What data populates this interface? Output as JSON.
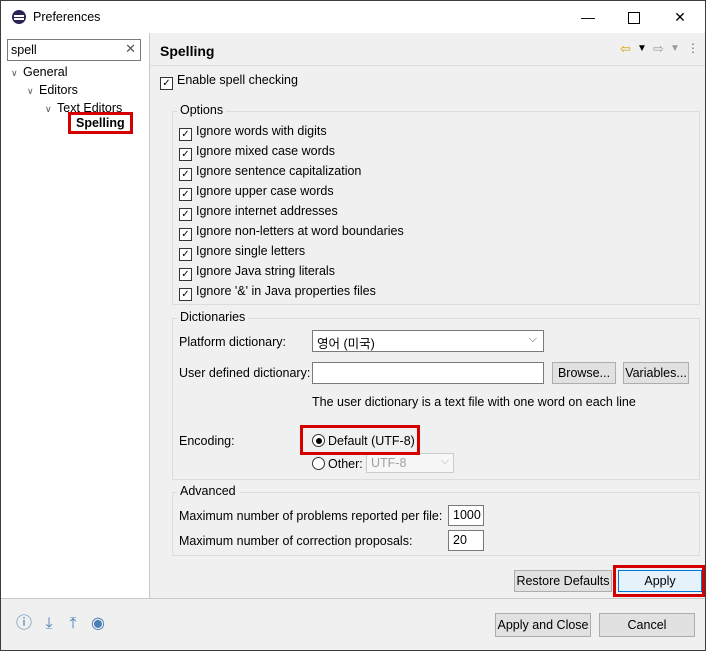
{
  "window": {
    "title": "Preferences",
    "minimize": "—",
    "close": "✕"
  },
  "filter": {
    "value": "spell",
    "clear": "✕"
  },
  "tree": {
    "general": "General",
    "editors": "Editors",
    "text_editors": "Text Editors",
    "spelling": "Spelling"
  },
  "page": {
    "title": "Spelling",
    "enable_spell": "Enable spell checking"
  },
  "options": {
    "label": "Options",
    "items": [
      "Ignore words with digits",
      "Ignore mixed case words",
      "Ignore sentence capitalization",
      "Ignore upper case words",
      "Ignore internet addresses",
      "Ignore non-letters at word boundaries",
      "Ignore single letters",
      "Ignore Java string literals",
      "Ignore '&' in Java properties files"
    ]
  },
  "dictionaries": {
    "label": "Dictionaries",
    "platform_label": "Platform dictionary:",
    "platform_value": "영어 (미국)",
    "user_label": "User defined dictionary:",
    "user_value": "",
    "browse": "Browse...",
    "variables": "Variables...",
    "hint": "The user dictionary is a text file with one word on each line",
    "encoding_label": "Encoding:",
    "default_option": "Default (UTF-8)",
    "other_option": "Other:",
    "other_value": "UTF-8"
  },
  "advanced": {
    "label": "Advanced",
    "max_problems_label": "Maximum number of problems reported per file:",
    "max_problems_value": "1000",
    "max_proposals_label": "Maximum number of correction proposals:",
    "max_proposals_value": "20"
  },
  "buttons": {
    "restore_defaults": "Restore Defaults",
    "apply": "Apply",
    "apply_close": "Apply and Close",
    "cancel": "Cancel"
  },
  "colors": {
    "highlight": "#d40000",
    "accent": "#0078d7"
  }
}
